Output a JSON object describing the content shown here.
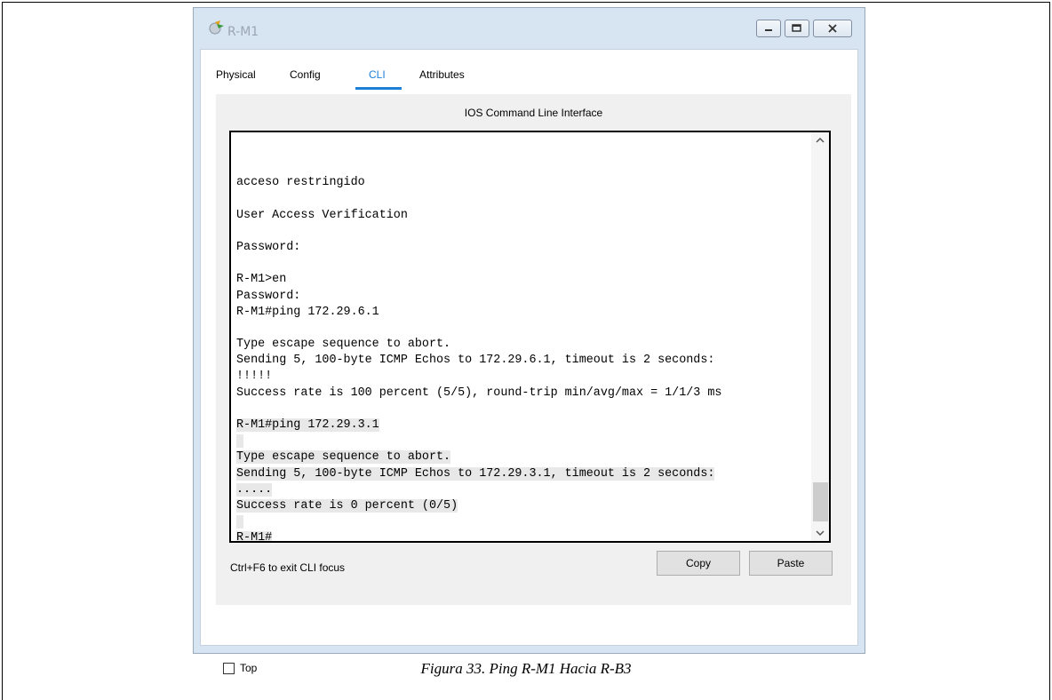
{
  "window": {
    "title": "R-M1",
    "controls": [
      "minimize",
      "maximize",
      "close"
    ]
  },
  "tabs": [
    {
      "label": "Physical",
      "active": false
    },
    {
      "label": "Config",
      "active": false
    },
    {
      "label": "CLI",
      "active": true
    },
    {
      "label": "Attributes",
      "active": false
    }
  ],
  "cli": {
    "heading": "IOS Command Line Interface",
    "lines": [
      "",
      "acceso restringido",
      "",
      "User Access Verification",
      "",
      "Password:",
      "",
      "R-M1>en",
      "Password:",
      "R-M1#ping 172.29.6.1",
      "",
      "Type escape sequence to abort.",
      "Sending 5, 100-byte ICMP Echos to 172.29.6.1, timeout is 2 seconds:",
      "!!!!!",
      "Success rate is 100 percent (5/5), round-trip min/avg/max = 1/1/3 ms",
      "",
      "R-M1#ping 172.29.3.1",
      "",
      "Type escape sequence to abort.",
      "Sending 5, 100-byte ICMP Echos to 172.29.3.1, timeout is 2 seconds:",
      ".....",
      "Success rate is 0 percent (0/5)",
      "",
      "R-M1#"
    ],
    "hint": "Ctrl+F6 to exit CLI focus",
    "copy_label": "Copy",
    "paste_label": "Paste"
  },
  "top_checkbox": {
    "label": "Top",
    "checked": false
  },
  "caption": "Figura 33. Ping R-M1 Hacia R-B3",
  "colors": {
    "accent": "#1f7fd6",
    "window_frame": "#d7e5f3"
  }
}
